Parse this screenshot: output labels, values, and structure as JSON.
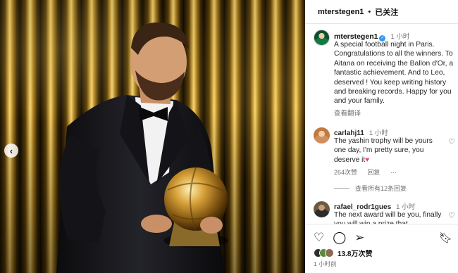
{
  "header": {
    "username": "mterstegen1",
    "separator": "•",
    "follow_status": "已关注"
  },
  "caption": {
    "username": "mterstegen1",
    "time": "1 小时",
    "text": "A special football night in Paris. Congratulations to all the winners. To Aitana on receiving the Ballon d'Or, a fantastic achievement. And to Leo, deserved ! You keep writing history and breaking records. Happy for you and your family.",
    "translate_label": "查看翻译"
  },
  "comments": [
    {
      "username": "carlahj11",
      "time": "1 小时",
      "text": "The yashin trophy will be yours one day, I'm pretty sure, you deserve it",
      "heart_emoji": "♥",
      "likes": "264次赞",
      "reply_label": "回复",
      "more_label": "···",
      "view_replies": "查看所有12条回复"
    },
    {
      "username": "rafael_rodr1gues",
      "time": "1 小时",
      "text": "The next award will be you, finally you will win a prize that"
    }
  ],
  "actions": {
    "like_icon": "heart-outline-icon",
    "comment_icon": "comment-bubble-icon",
    "share_icon": "paper-plane-icon",
    "save_icon": "bookmark-icon",
    "likes_count": "13.8万次赞",
    "post_time": "1 小时前"
  },
  "colors": {
    "accent": "#3897f0",
    "heart": "#ed4956",
    "secondary_text": "#737373"
  }
}
